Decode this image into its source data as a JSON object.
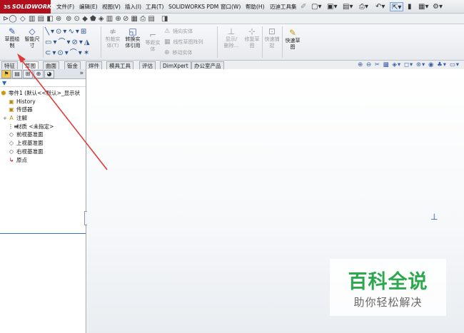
{
  "app": {
    "logo": "SOLIDWORKS",
    "logo_mark": "3S"
  },
  "menu": [
    "文件(F)",
    "编辑(E)",
    "视图(V)",
    "插入(I)",
    "工具(T)",
    "SOLIDWORKS PDM",
    "窗口(W)",
    "帮助(H)",
    "迈迪工具集"
  ],
  "command_manager": {
    "sketch_label": "草图绘\n制",
    "smart_dim_label": "智能尺\n寸",
    "trim_label": "剪裁实\n体(T)",
    "convert_label": "转换实\n体引用",
    "offset_label": "等距实\n体",
    "mirror_label": "镜向实体",
    "linear_pattern_label": "线性草图阵列",
    "move_label": "移动实体",
    "display_delete_label": "显示/\n删除...",
    "repair_label": "修复草\n图",
    "quick_snap_label": "快速捕\n捉",
    "rapid_sketch_label": "快速草\n图"
  },
  "tabs": [
    "特征",
    "草图",
    "曲面",
    "钣金",
    "焊件",
    "模具工具",
    "评估",
    "DimXpert",
    "办公室产品"
  ],
  "active_tab": "草图",
  "feature_tree": {
    "root": "零件1  (默认<<默认>_显示状",
    "items": [
      {
        "label": "History",
        "icon": "history-icon"
      },
      {
        "label": "传感器",
        "icon": "sensor-icon"
      },
      {
        "label": "注解",
        "icon": "annotation-icon"
      },
      {
        "label": "材质 <未指定>",
        "icon": "material-icon"
      },
      {
        "label": "前视基准面",
        "icon": "plane-icon"
      },
      {
        "label": "上视基准面",
        "icon": "plane-icon"
      },
      {
        "label": "右视基准面",
        "icon": "plane-icon"
      },
      {
        "label": "原点",
        "icon": "origin-icon"
      }
    ]
  },
  "watermark": {
    "title": "百科全说",
    "subtitle": "助你轻松解决"
  },
  "colors": {
    "brand_red": "#b0101b",
    "watermark_green": "#2da84e",
    "arrow_red": "#e03a3a",
    "triad_blue": "#1f4fb6"
  }
}
